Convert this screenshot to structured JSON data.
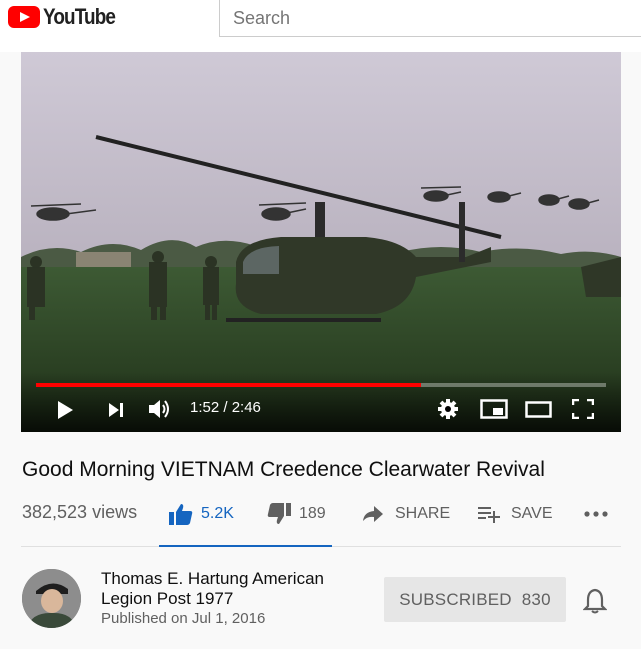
{
  "masthead": {
    "logo_text": "YouTube",
    "search_placeholder": "Search"
  },
  "player": {
    "current_time": "1:52",
    "duration": "2:46",
    "time_display": "1:52 / 2:46",
    "progress_fraction": 0.675,
    "buffered_fraction": 1.0,
    "progress_color": "#ff0000"
  },
  "video": {
    "title": "Good Morning VIETNAM Creedence Clearwater Revival",
    "views": "382,523 views",
    "likes": "5.2K",
    "dislikes": "189",
    "share_label": "SHARE",
    "save_label": "SAVE"
  },
  "channel": {
    "name": "Thomas E. Hartung American Legion Post 1977",
    "published": "Published on Jul 1, 2016",
    "subscribe_label": "SUBSCRIBED",
    "subscriber_count": "830"
  },
  "colors": {
    "accent": "#1565c0",
    "brand": "#ff0000"
  },
  "icons": [
    "play-icon",
    "next-icon",
    "volume-icon",
    "settings-icon",
    "miniplayer-icon",
    "theater-icon",
    "fullscreen-icon",
    "thumbs-up-icon",
    "thumbs-down-icon",
    "share-icon",
    "playlist-add-icon",
    "more-icon",
    "bell-icon"
  ]
}
